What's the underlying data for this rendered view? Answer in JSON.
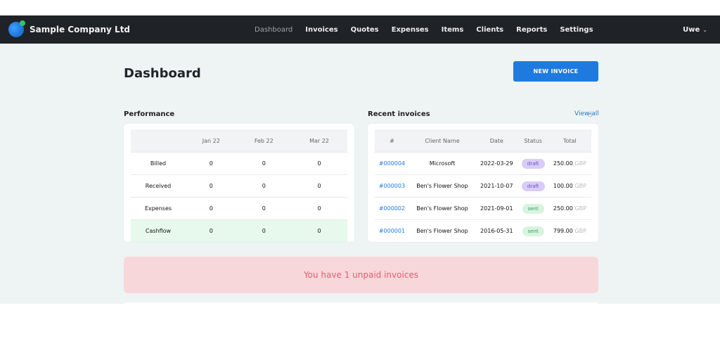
{
  "brand": {
    "name": "Sample Company Ltd"
  },
  "nav": {
    "items": [
      "Dashboard",
      "Invoices",
      "Quotes",
      "Expenses",
      "Items",
      "Clients",
      "Reports",
      "Settings"
    ]
  },
  "user": {
    "name": "Uwe"
  },
  "page": {
    "title": "Dashboard",
    "new_invoice_label": "NEW INVOICE"
  },
  "performance": {
    "title": "Performance",
    "columns": [
      "Jan 22",
      "Feb 22",
      "Mar 22"
    ],
    "rows": [
      {
        "label": "Billed",
        "values": [
          "0",
          "0",
          "0"
        ]
      },
      {
        "label": "Received",
        "values": [
          "0",
          "0",
          "0"
        ]
      },
      {
        "label": "Expenses",
        "values": [
          "0",
          "0",
          "0"
        ]
      },
      {
        "label": "Cashflow",
        "values": [
          "0",
          "0",
          "0"
        ]
      }
    ]
  },
  "recent": {
    "title": "Recent invoices",
    "view_all_label": "View all",
    "columns": [
      "#",
      "Client Name",
      "Date",
      "Status",
      "Total"
    ],
    "rows": [
      {
        "number": "#000004",
        "client": "Microsoft",
        "date": "2022-03-29",
        "status": "draft",
        "amount": "250.00",
        "currency": "GBP"
      },
      {
        "number": "#000003",
        "client": "Ben's Flower Shop",
        "date": "2021-10-07",
        "status": "draft",
        "amount": "100.00",
        "currency": "GBP"
      },
      {
        "number": "#000002",
        "client": "Ben's Flower Shop",
        "date": "2021-09-01",
        "status": "sent",
        "amount": "250.00",
        "currency": "GBP"
      },
      {
        "number": "#000001",
        "client": "Ben's Flower Shop",
        "date": "2016-05-31",
        "status": "sent",
        "amount": "799.00",
        "currency": "GBP"
      }
    ]
  },
  "alert": {
    "text": "You have 1 unpaid invoices"
  },
  "colors": {
    "accent": "#1f7ae0",
    "navbar": "#1f2227",
    "alert_bg": "#f8d7da",
    "alert_text": "#e06070"
  }
}
